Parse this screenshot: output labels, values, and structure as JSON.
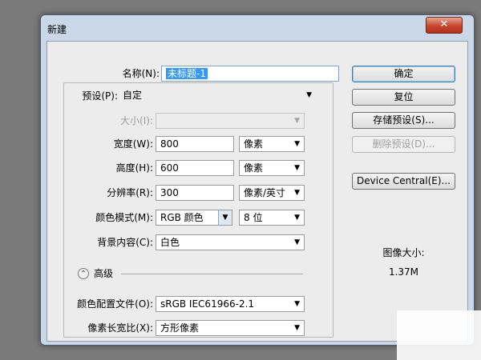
{
  "dialog": {
    "title": "新建",
    "close_symbol": "✕"
  },
  "fields": {
    "name": {
      "label": "名称(N):",
      "value": "未标题-1"
    },
    "preset": {
      "label": "预设(P):",
      "value": "自定"
    },
    "size": {
      "label": "大小(I):",
      "value": ""
    },
    "width": {
      "label": "宽度(W):",
      "value": "800",
      "unit": "像素"
    },
    "height": {
      "label": "高度(H):",
      "value": "600",
      "unit": "像素"
    },
    "resolution": {
      "label": "分辨率(R):",
      "value": "300",
      "unit": "像素/英寸"
    },
    "color_mode": {
      "label": "颜色模式(M):",
      "value": "RGB 颜色",
      "depth": "8 位"
    },
    "background": {
      "label": "背景内容(C):",
      "value": "白色"
    },
    "advanced": {
      "label": "高级"
    },
    "color_profile": {
      "label": "颜色配置文件(O):",
      "value": "sRGB IEC61966-2.1"
    },
    "pixel_aspect": {
      "label": "像素长宽比(X):",
      "value": "方形像素"
    }
  },
  "buttons": {
    "ok": "确定",
    "reset": "复位",
    "save_preset": "存储预设(S)...",
    "delete_preset": "删除预设(D)...",
    "device_central": "Device Central(E)..."
  },
  "image_size": {
    "label": "图像大小:",
    "value": "1.37M"
  },
  "icons": {
    "dropdown": "▼",
    "collapse": "⌃"
  }
}
